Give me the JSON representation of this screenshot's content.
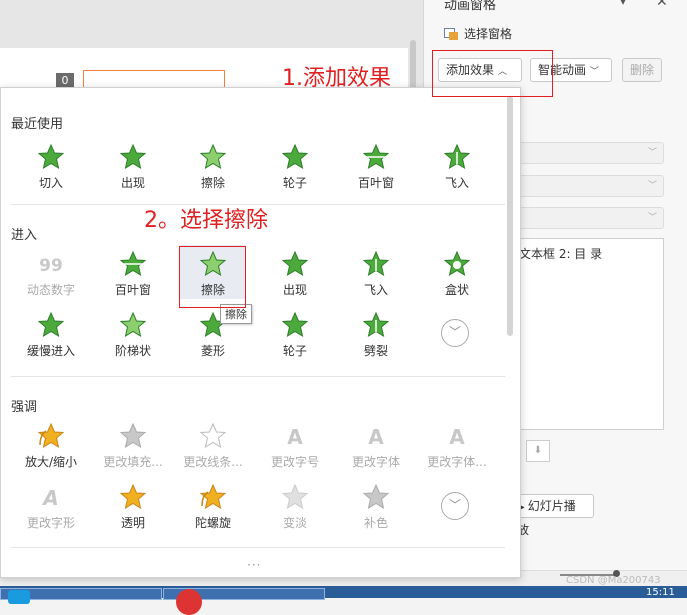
{
  "right_pane": {
    "title": "动画窗格",
    "selection_pane": "选择窗格",
    "add_effect": "添加效果",
    "smart_animation": "智能动画",
    "delete": "删除",
    "list_item": "文本框 2: 目 录",
    "slideshow": "幻灯片播放"
  },
  "slide": {
    "badge": "0"
  },
  "dropdown": {
    "sections": [
      {
        "title": "最近使用",
        "items": [
          {
            "label": "切入",
            "icon": "star-green-icon",
            "disabled": false
          },
          {
            "label": "出现",
            "icon": "star-green-burst-icon",
            "disabled": false
          },
          {
            "label": "擦除",
            "icon": "star-green-light-icon",
            "disabled": false
          },
          {
            "label": "轮子",
            "icon": "star-green-wheel-icon",
            "disabled": false
          },
          {
            "label": "百叶窗",
            "icon": "star-green-blinds-icon",
            "disabled": false
          },
          {
            "label": "飞入",
            "icon": "star-green-fly-icon",
            "disabled": false
          }
        ]
      },
      {
        "title": "进入",
        "items": [
          {
            "label": "动态数字",
            "icon": "dynamic-number-icon",
            "disabled": true
          },
          {
            "label": "百叶窗",
            "icon": "star-green-blinds-icon",
            "disabled": false
          },
          {
            "label": "擦除",
            "icon": "star-green-light-icon",
            "disabled": false
          },
          {
            "label": "出现",
            "icon": "star-green-burst-icon",
            "disabled": false
          },
          {
            "label": "飞入",
            "icon": "star-green-fly-icon",
            "disabled": false
          },
          {
            "label": "盒状",
            "icon": "star-green-box-icon",
            "disabled": false
          },
          {
            "label": "缓慢进入",
            "icon": "star-green-icon",
            "disabled": false
          },
          {
            "label": "阶梯状",
            "icon": "star-green-light-icon",
            "disabled": false
          },
          {
            "label": "菱形",
            "icon": "star-green-icon",
            "disabled": false
          },
          {
            "label": "轮子",
            "icon": "star-green-wheel-icon",
            "disabled": false
          },
          {
            "label": "劈裂",
            "icon": "star-green-split-icon",
            "disabled": false
          }
        ]
      },
      {
        "title": "强调",
        "items": [
          {
            "label": "放大/缩小",
            "icon": "star-gold-grow-icon",
            "disabled": false
          },
          {
            "label": "更改填充...",
            "icon": "star-gray-icon",
            "disabled": true
          },
          {
            "label": "更改线条...",
            "icon": "star-outline-icon",
            "disabled": true
          },
          {
            "label": "更改字号",
            "icon": "font-size-icon",
            "disabled": true
          },
          {
            "label": "更改字体",
            "icon": "font-change-icon",
            "disabled": true
          },
          {
            "label": "更改字体...",
            "icon": "font-color-icon",
            "disabled": true
          },
          {
            "label": "更改字形",
            "icon": "font-style-icon",
            "disabled": true
          },
          {
            "label": "透明",
            "icon": "star-gold-half-icon",
            "disabled": false
          },
          {
            "label": "陀螺旋",
            "icon": "star-gold-spin-icon",
            "disabled": false
          },
          {
            "label": "变淡",
            "icon": "star-gray-light-icon",
            "disabled": true
          },
          {
            "label": "补色",
            "icon": "star-gray-icon",
            "disabled": true
          }
        ]
      }
    ],
    "tooltip": "擦除",
    "grip": "···"
  },
  "annotations": {
    "step1": "1.添加效果",
    "step2": "2。选择擦除"
  },
  "status": {
    "watermark": "CSDN @Ma200743",
    "clock": "15:11"
  },
  "colors": {
    "annotation": "#e02020",
    "star_green": "#4caa3c",
    "star_gold": "#f0b020",
    "disabled_gray": "#c8c8c8"
  }
}
